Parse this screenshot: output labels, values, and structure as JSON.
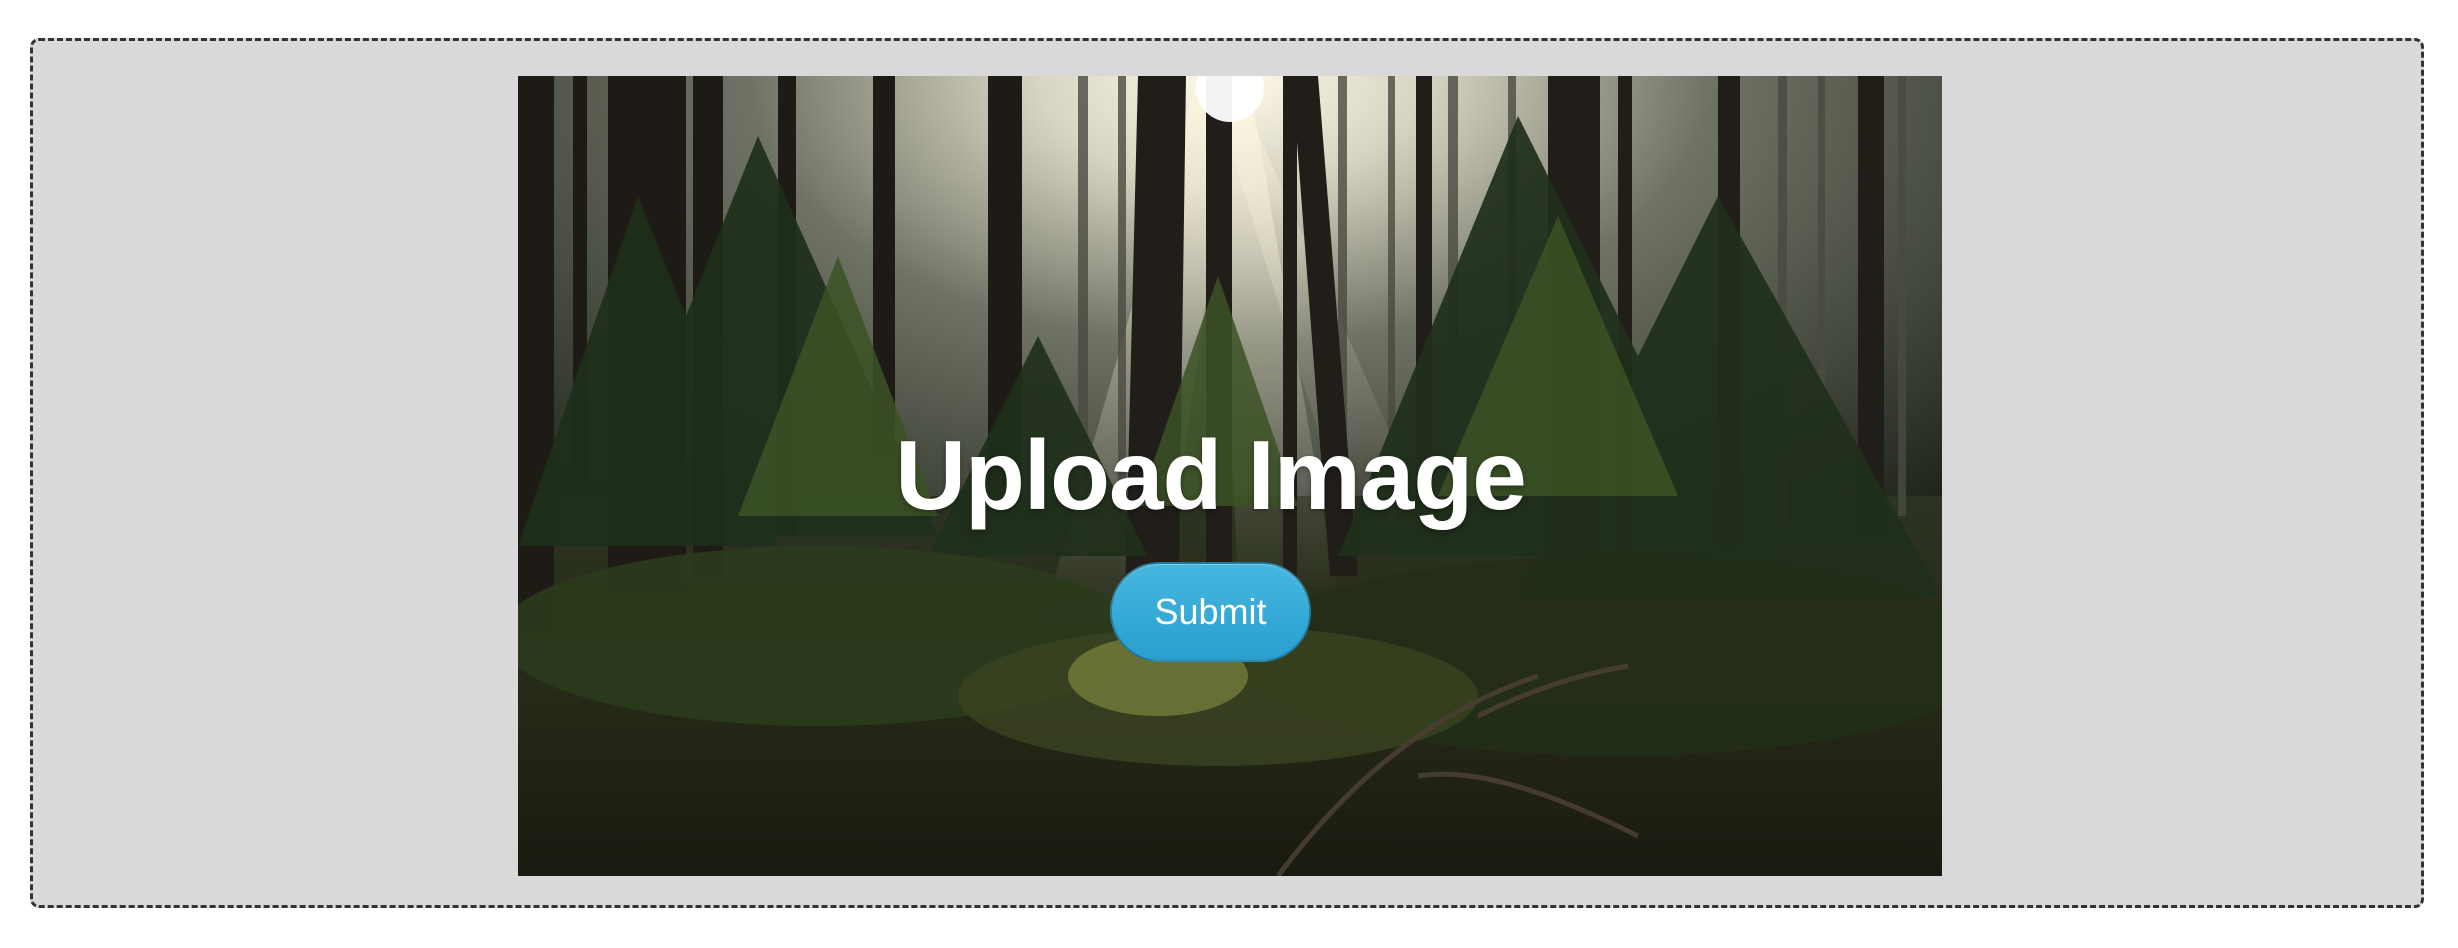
{
  "upload": {
    "title": "Upload Image",
    "submit_label": "Submit"
  },
  "colors": {
    "dropzone_background": "#d9d9d9",
    "dropzone_border": "#333333",
    "button_top": "#45b7e0",
    "button_bottom": "#2a9fce",
    "title_text": "#ffffff"
  }
}
